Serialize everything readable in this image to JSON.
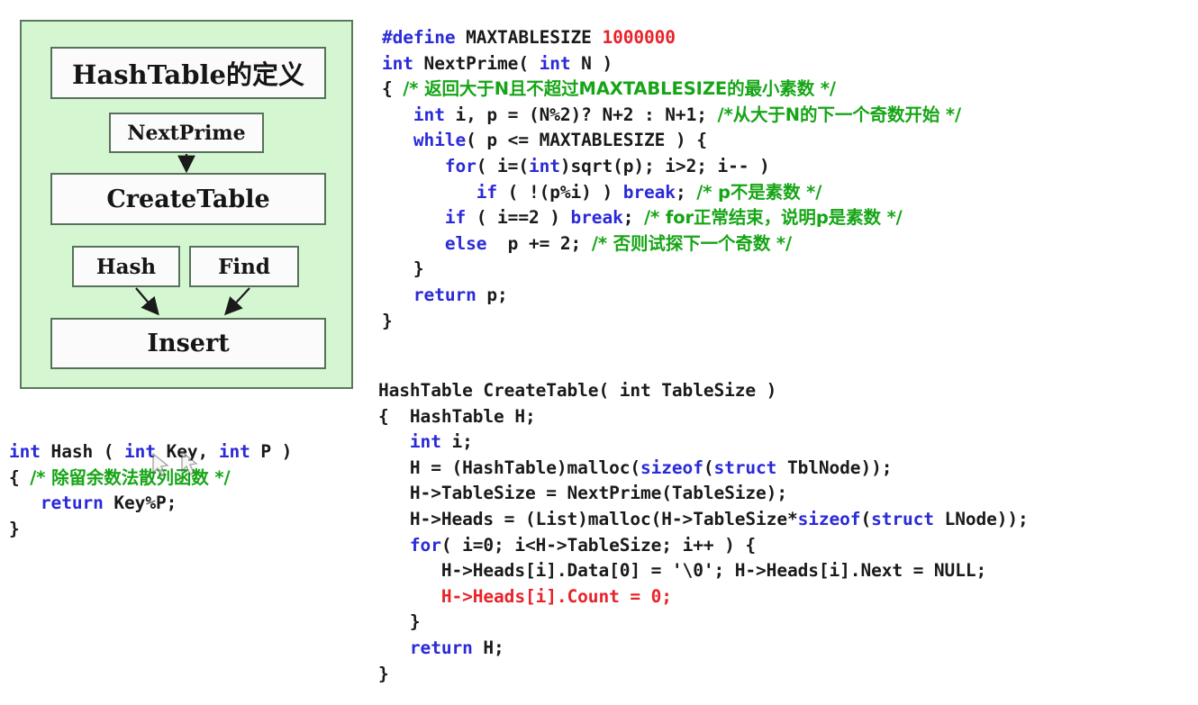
{
  "diagram": {
    "panel_bg": "#d4f7d2",
    "panel_border": "#5a7a5a",
    "boxes": [
      {
        "id": "title",
        "label": "HashTable的定义"
      },
      {
        "id": "nextprime",
        "label": "NextPrime"
      },
      {
        "id": "createtable",
        "label": "CreateTable"
      },
      {
        "id": "hash",
        "label": "Hash"
      },
      {
        "id": "find",
        "label": "Find"
      },
      {
        "id": "insert",
        "label": "Insert"
      }
    ],
    "arrows": [
      {
        "from": "nextprime",
        "to": "createtable"
      },
      {
        "from": "hash",
        "to": "insert"
      },
      {
        "from": "find",
        "to": "insert"
      }
    ]
  },
  "colors": {
    "keyword": "#2a2ad8",
    "number": "#e8232a",
    "comment": "#16a516",
    "plain": "#1a1a1a",
    "highlight_red": "#e8232a"
  },
  "code_nextprime": {
    "title": "NextPrime",
    "lines": [
      {
        "tokens": [
          {
            "t": "#define ",
            "c": "pp"
          },
          {
            "t": "MAXTABLESIZE ",
            "c": "plain"
          },
          {
            "t": "1000000",
            "c": "num"
          }
        ]
      },
      {
        "tokens": [
          {
            "t": "int",
            "c": "kw"
          },
          {
            "t": " NextPrime( ",
            "c": "plain"
          },
          {
            "t": "int",
            "c": "kw"
          },
          {
            "t": " N )",
            "c": "plain"
          }
        ]
      },
      {
        "tokens": [
          {
            "t": "{ ",
            "c": "plain"
          },
          {
            "t": "/* 返回大于N且不超过MAXTABLESIZE的最小素数 */",
            "c": "cmt"
          }
        ]
      },
      {
        "tokens": [
          {
            "t": "   ",
            "c": "plain"
          },
          {
            "t": "int",
            "c": "kw"
          },
          {
            "t": " i, p = (N%2)? N+2 : N+1; ",
            "c": "plain"
          },
          {
            "t": "/*从大于N的下一个奇数开始 */",
            "c": "cmt"
          }
        ]
      },
      {
        "tokens": [
          {
            "t": "   ",
            "c": "plain"
          },
          {
            "t": "while",
            "c": "kw"
          },
          {
            "t": "( p <= MAXTABLESIZE ) {",
            "c": "plain"
          }
        ]
      },
      {
        "tokens": [
          {
            "t": "      ",
            "c": "plain"
          },
          {
            "t": "for",
            "c": "kw"
          },
          {
            "t": "( i=(",
            "c": "plain"
          },
          {
            "t": "int",
            "c": "kw"
          },
          {
            "t": ")sqrt(p); i>2; i-- )",
            "c": "plain"
          }
        ]
      },
      {
        "tokens": [
          {
            "t": "         ",
            "c": "plain"
          },
          {
            "t": "if",
            "c": "kw"
          },
          {
            "t": " ( !(p%i) ) ",
            "c": "plain"
          },
          {
            "t": "break",
            "c": "kw"
          },
          {
            "t": "; ",
            "c": "plain"
          },
          {
            "t": "/* p不是素数 */",
            "c": "cmt"
          }
        ]
      },
      {
        "tokens": [
          {
            "t": "      ",
            "c": "plain"
          },
          {
            "t": "if",
            "c": "kw"
          },
          {
            "t": " ( i==2 ) ",
            "c": "plain"
          },
          {
            "t": "break",
            "c": "kw"
          },
          {
            "t": "; ",
            "c": "plain"
          },
          {
            "t": "/* for正常结束，说明p是素数 */",
            "c": "cmt"
          }
        ]
      },
      {
        "tokens": [
          {
            "t": "      ",
            "c": "plain"
          },
          {
            "t": "else",
            "c": "kw"
          },
          {
            "t": "  p += 2; ",
            "c": "plain"
          },
          {
            "t": "/* 否则试探下一个奇数 */",
            "c": "cmt"
          }
        ]
      },
      {
        "tokens": [
          {
            "t": "   }",
            "c": "plain"
          }
        ]
      },
      {
        "tokens": [
          {
            "t": "   ",
            "c": "plain"
          },
          {
            "t": "return",
            "c": "kw"
          },
          {
            "t": " p;",
            "c": "plain"
          }
        ]
      },
      {
        "tokens": [
          {
            "t": "}",
            "c": "plain"
          }
        ]
      }
    ]
  },
  "code_createtable": {
    "title": "CreateTable",
    "lines": [
      {
        "tokens": [
          {
            "t": "HashTable CreateTable( int TableSize )",
            "c": "plain"
          }
        ]
      },
      {
        "tokens": [
          {
            "t": "{  HashTable H;",
            "c": "plain"
          }
        ]
      },
      {
        "tokens": [
          {
            "t": "   ",
            "c": "plain"
          },
          {
            "t": "int",
            "c": "kw"
          },
          {
            "t": " i;",
            "c": "plain"
          }
        ]
      },
      {
        "tokens": [
          {
            "t": "   H = (HashTable)malloc(",
            "c": "plain"
          },
          {
            "t": "sizeof",
            "c": "kw"
          },
          {
            "t": "(",
            "c": "plain"
          },
          {
            "t": "struct",
            "c": "kw"
          },
          {
            "t": " TblNode));",
            "c": "plain"
          }
        ]
      },
      {
        "tokens": [
          {
            "t": "   H->TableSize = NextPrime(TableSize);",
            "c": "plain"
          }
        ]
      },
      {
        "tokens": [
          {
            "t": "   H->Heads = (List)malloc(H->TableSize*",
            "c": "plain"
          },
          {
            "t": "sizeof",
            "c": "kw"
          },
          {
            "t": "(",
            "c": "plain"
          },
          {
            "t": "struct",
            "c": "kw"
          },
          {
            "t": " LNode));",
            "c": "plain"
          }
        ]
      },
      {
        "tokens": [
          {
            "t": "   ",
            "c": "plain"
          },
          {
            "t": "for",
            "c": "kw"
          },
          {
            "t": "( i=0; i<H->TableSize; i++ ) {",
            "c": "plain"
          }
        ]
      },
      {
        "tokens": [
          {
            "t": "      H->Heads[i].Data[0] = '\\0'; H->Heads[i].Next = NULL;",
            "c": "plain"
          }
        ]
      },
      {
        "tokens": [
          {
            "t": "      H->Heads[i].Count = 0;",
            "c": "red"
          }
        ]
      },
      {
        "tokens": [
          {
            "t": "   }",
            "c": "plain"
          }
        ]
      },
      {
        "tokens": [
          {
            "t": "   ",
            "c": "plain"
          },
          {
            "t": "return",
            "c": "kw"
          },
          {
            "t": " H;",
            "c": "plain"
          }
        ]
      },
      {
        "tokens": [
          {
            "t": "}",
            "c": "plain"
          }
        ]
      }
    ]
  },
  "code_hash": {
    "title": "Hash",
    "lines": [
      {
        "tokens": [
          {
            "t": "int",
            "c": "kw"
          },
          {
            "t": " Hash ( ",
            "c": "plain"
          },
          {
            "t": "int",
            "c": "kw"
          },
          {
            "t": " Key, ",
            "c": "plain"
          },
          {
            "t": "int",
            "c": "kw"
          },
          {
            "t": " P )",
            "c": "plain"
          }
        ]
      },
      {
        "tokens": [
          {
            "t": "{ ",
            "c": "plain"
          },
          {
            "t": "/* 除留余数法散列函数 */",
            "c": "cmt"
          }
        ]
      },
      {
        "tokens": [
          {
            "t": "   ",
            "c": "plain"
          },
          {
            "t": "return",
            "c": "kw"
          },
          {
            "t": " Key%P;",
            "c": "plain"
          }
        ]
      },
      {
        "tokens": [
          {
            "t": "}",
            "c": "plain"
          }
        ]
      }
    ]
  }
}
